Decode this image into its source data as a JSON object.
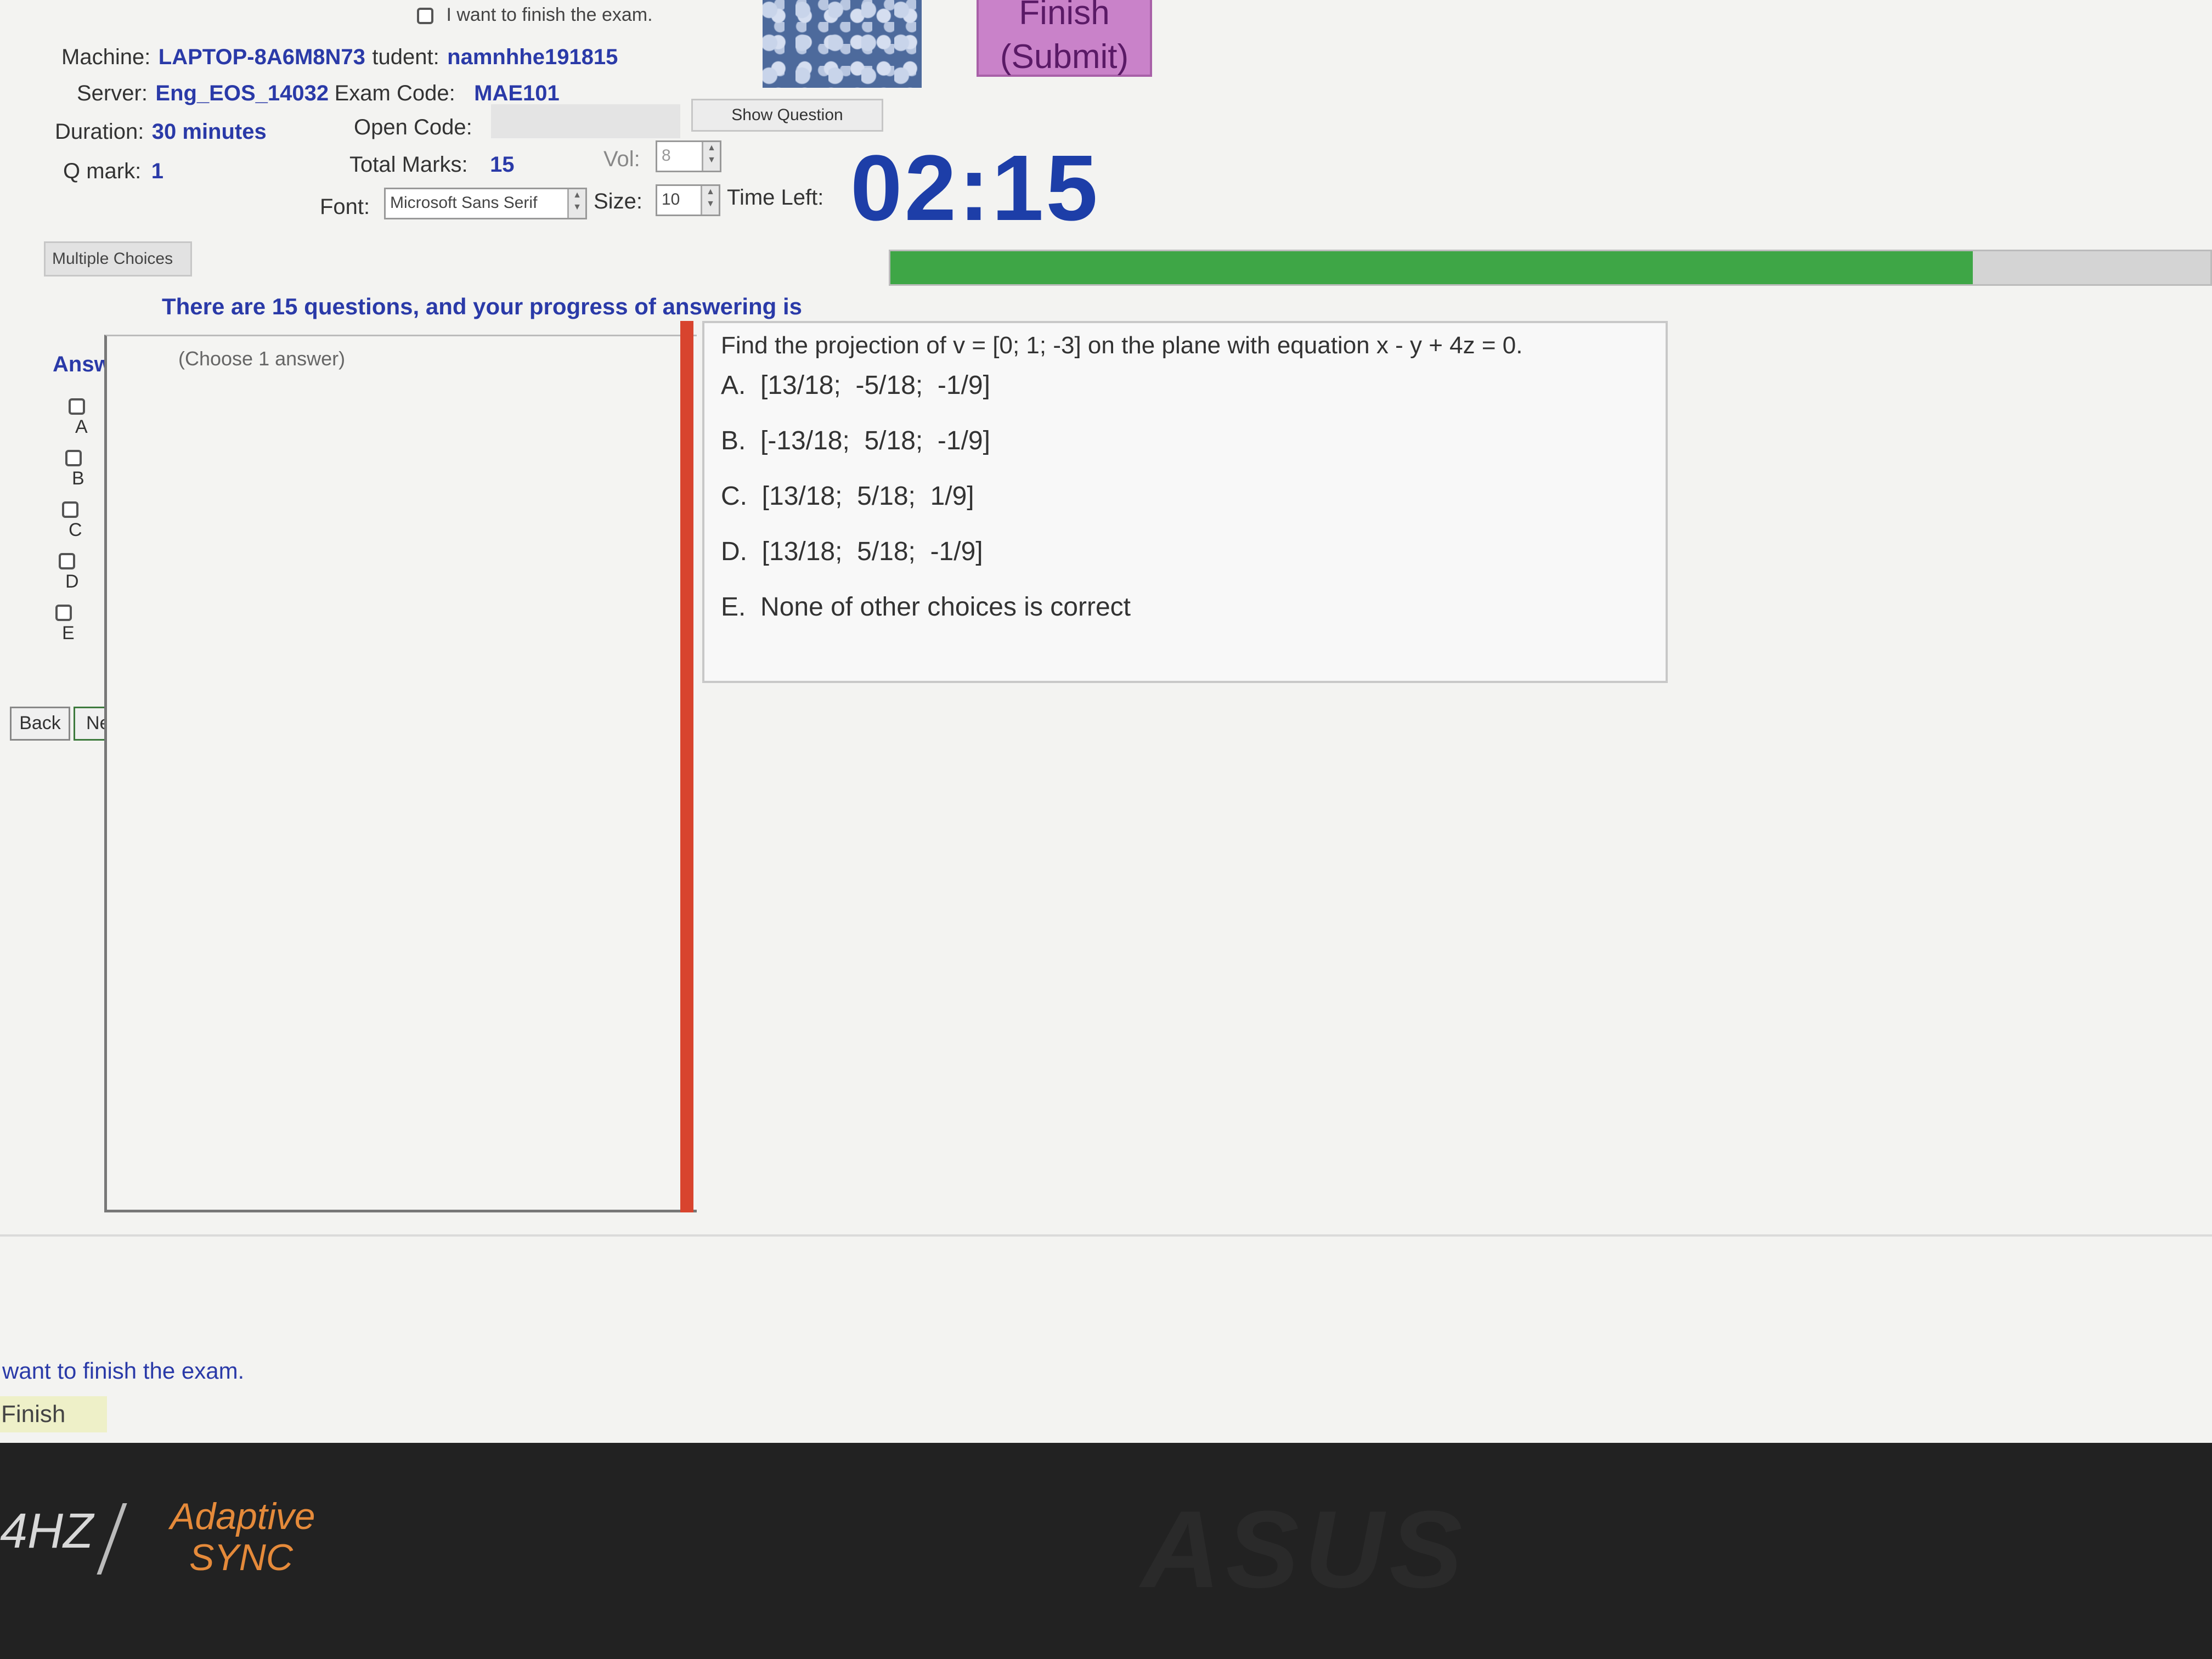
{
  "header": {
    "finish_check_label": "I want to finish the exam.",
    "machine_label": "Machine:",
    "machine_value": "LAPTOP-8A6M8N73",
    "student_label": "tudent:",
    "student_value": "namnhhe191815",
    "server_label": "Server:",
    "server_value": "Eng_EOS_14032",
    "exam_code_label": "Exam Code:",
    "exam_code_value": "MAE101",
    "duration_label": "Duration:",
    "duration_value": "30 minutes",
    "open_code_label": "Open Code:",
    "show_question_label": "Show Question",
    "qmark_label": "Q mark:",
    "qmark_value": "1",
    "total_marks_label": "Total Marks:",
    "total_marks_value": "15",
    "vol_label": "Vol:",
    "vol_value": "8",
    "font_label": "Font:",
    "font_value": "Microsoft Sans Serif",
    "size_label": "Size:",
    "size_value": "10",
    "time_left_label": "Time Left:",
    "time_left_value": "02:15",
    "finish_submit_line1": "Finish",
    "finish_submit_line2": "(Submit)"
  },
  "tabs": {
    "multiple_choices": "Multiple Choices"
  },
  "progress": {
    "text": "There are 15 questions, and your progress of answering is",
    "fraction": 0.82,
    "color": "#3ea646"
  },
  "answer": {
    "header": "Answer",
    "hint": "(Choose 1 answer)",
    "options": [
      "A",
      "B",
      "C",
      "D",
      "E"
    ]
  },
  "question": {
    "text": "Find the projection of v = [0; 1; -3]  on the plane with equation x - y + 4z = 0.",
    "choices": [
      "A.  [13/18;  -5/18;  -1/9]",
      "B.  [-13/18;  5/18;  -1/9]",
      "C.  [13/18;  5/18;  1/9]",
      "D.  [13/18;  5/18;  -1/9]",
      "E.  None of other choices is correct"
    ]
  },
  "nav": {
    "back": "Back",
    "next": "Next"
  },
  "footer": {
    "finish_check_label": "want to finish the exam.",
    "finish_button": "Finish"
  },
  "bezel": {
    "hz": "4HZ",
    "adaptive_line1": "Adaptive",
    "adaptive_line2": "SYNC",
    "brand": "ASUS"
  },
  "colors": {
    "timer": "#1d3ea8",
    "divider": "#d8442e",
    "finish_button": "#c982c9"
  }
}
